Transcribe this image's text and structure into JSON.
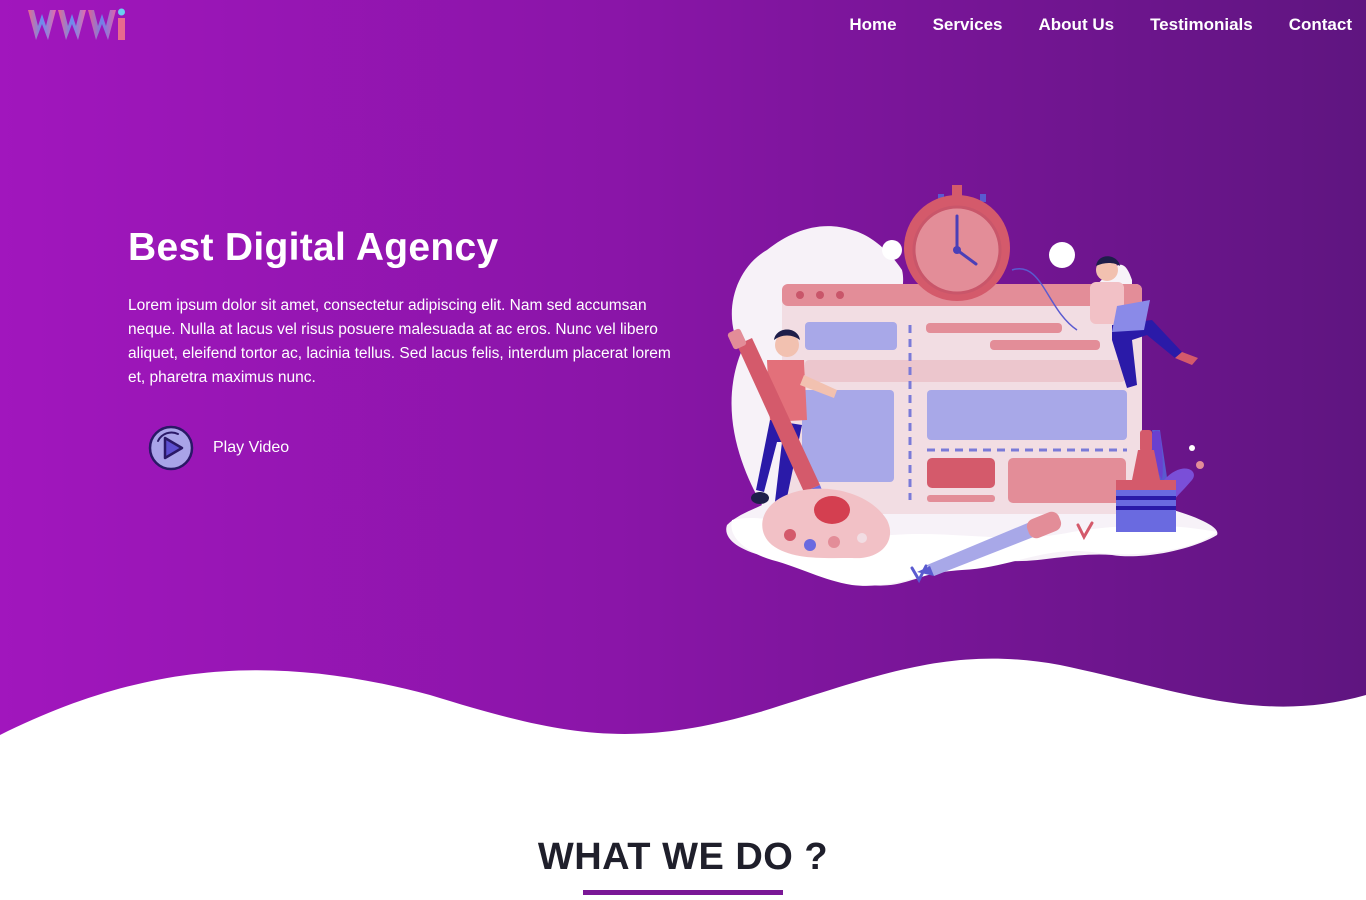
{
  "brand": {
    "logo_icon": "wm-logo-icon"
  },
  "nav": {
    "items": [
      {
        "label": "Home"
      },
      {
        "label": "Services"
      },
      {
        "label": "About Us"
      },
      {
        "label": "Testimonials"
      },
      {
        "label": "Contact"
      }
    ]
  },
  "hero": {
    "title": "Best Digital Agency",
    "text": "Lorem ipsum dolor sit amet, consectetur adipiscing elit. Nam sed accumsan neque. Nulla at lacus vel risus posuere malesuada at ac eros. Nunc vel libero aliquet, eleifend tortor ac, lacinia tellus. Sed lacus felis, interdum placerat lorem et, pharetra maximus nunc.",
    "play_label": "Play Video",
    "play_icon": "play-circle-icon",
    "illustration_icon": "digital-agency-illustration-icon"
  },
  "section": {
    "title": "WHAT WE DO ?"
  },
  "colors": {
    "gradient_start": "#a116bd",
    "gradient_end": "#5f1580",
    "accent": "#7a1796",
    "heading": "#1f1f2b"
  }
}
